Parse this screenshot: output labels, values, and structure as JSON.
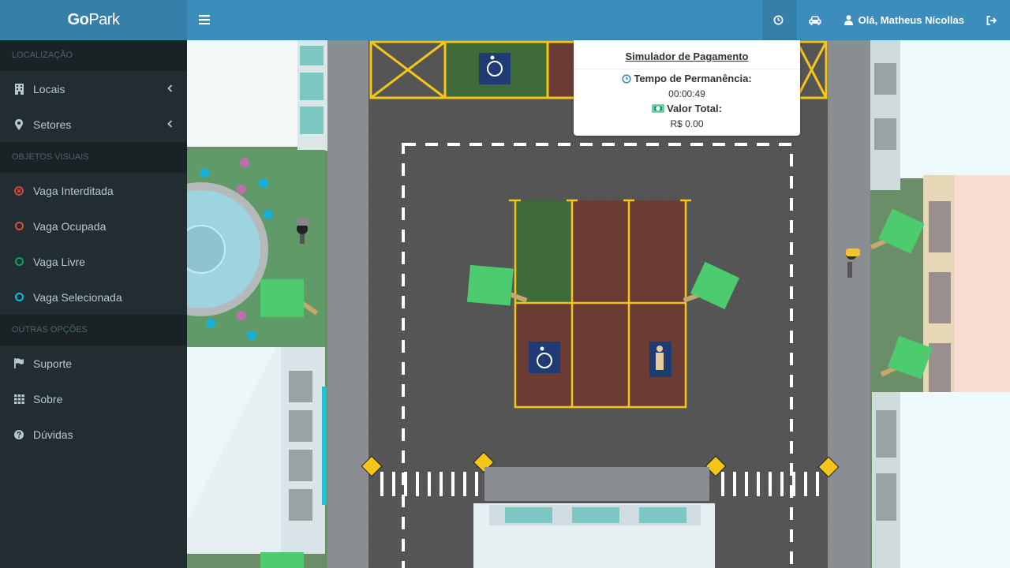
{
  "app": {
    "logo_part1": "Go",
    "logo_part2": "Park"
  },
  "topbar": {
    "greeting": "Olá, Matheus Nícollas",
    "icons": [
      "bars-icon",
      "clock-icon",
      "car-icon",
      "user-icon",
      "sign-out-icon"
    ]
  },
  "sidebar": {
    "section_location": "LOCALIZAÇÃO",
    "locais": "Locais",
    "setores": "Setores",
    "section_visual": "OBJETOS VISUAIS",
    "vaga_interditada": "Vaga Interditada",
    "vaga_ocupada": "Vaga Ocupada",
    "vaga_livre": "Vaga Livre",
    "vaga_selecionada": "Vaga Selecionada",
    "section_other": "OUTRAS OPÇÕES",
    "suporte": "Suporte",
    "sobre": "Sobre",
    "duvidas": "Dúvidas"
  },
  "colors": {
    "topbar": "#3c8dbc",
    "interditada": "#dd4b39",
    "ocupada": "#dd4b39",
    "livre": "#00a65a",
    "selecionada": "#00c0ef"
  },
  "simulator": {
    "title": "Simulador de Pagamento",
    "time_label": "Tempo de Permanência:",
    "time_value": "00:00:49",
    "total_label": "Valor Total:",
    "total_value": "R$ 0.00"
  }
}
